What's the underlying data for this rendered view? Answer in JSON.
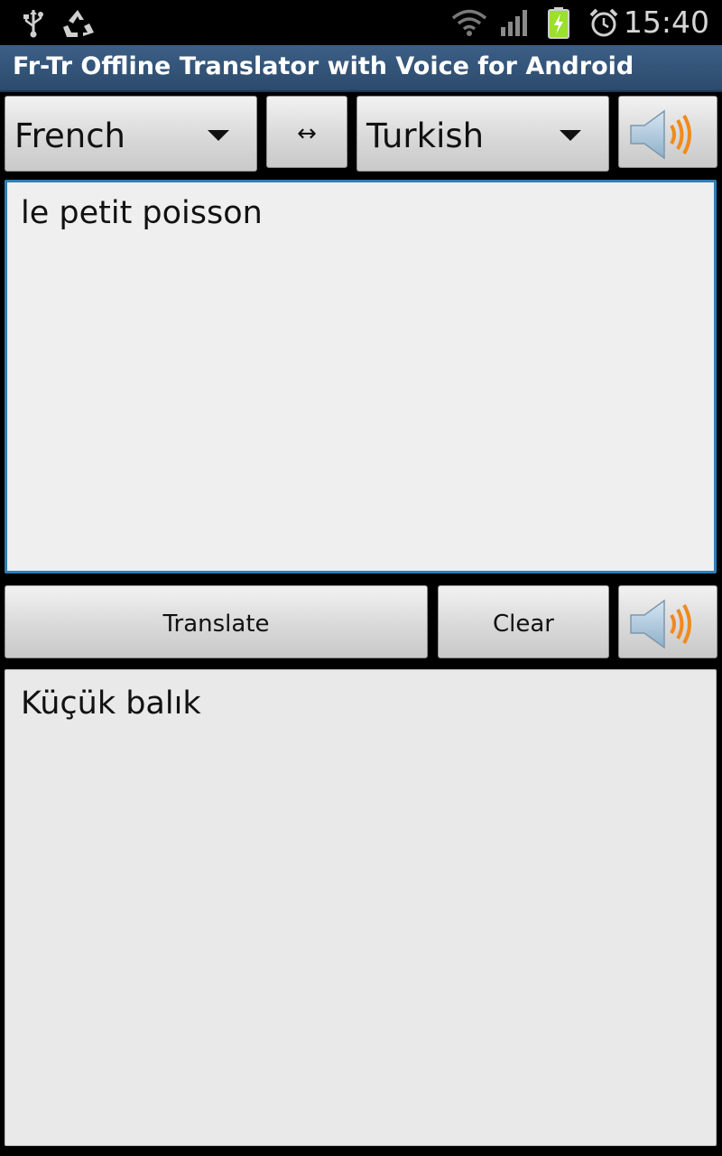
{
  "status_bar": {
    "time": "15:40",
    "icons": [
      "usb-icon",
      "recycle-icon",
      "wifi-icon",
      "signal-icon",
      "battery-charging-icon",
      "alarm-icon"
    ]
  },
  "app": {
    "title": "Fr-Tr Offline Translator with Voice for Android"
  },
  "toolbar": {
    "source_language": "French",
    "swap_label": "↔",
    "target_language": "Turkish"
  },
  "input": {
    "value": "le petit poisson"
  },
  "actions": {
    "translate_label": "Translate",
    "clear_label": "Clear"
  },
  "output": {
    "value": "Küçük balık"
  },
  "colors": {
    "title_bar": "#34577d",
    "input_focus_border": "#2f7fb5",
    "speaker_wave": "#f08a1a"
  }
}
